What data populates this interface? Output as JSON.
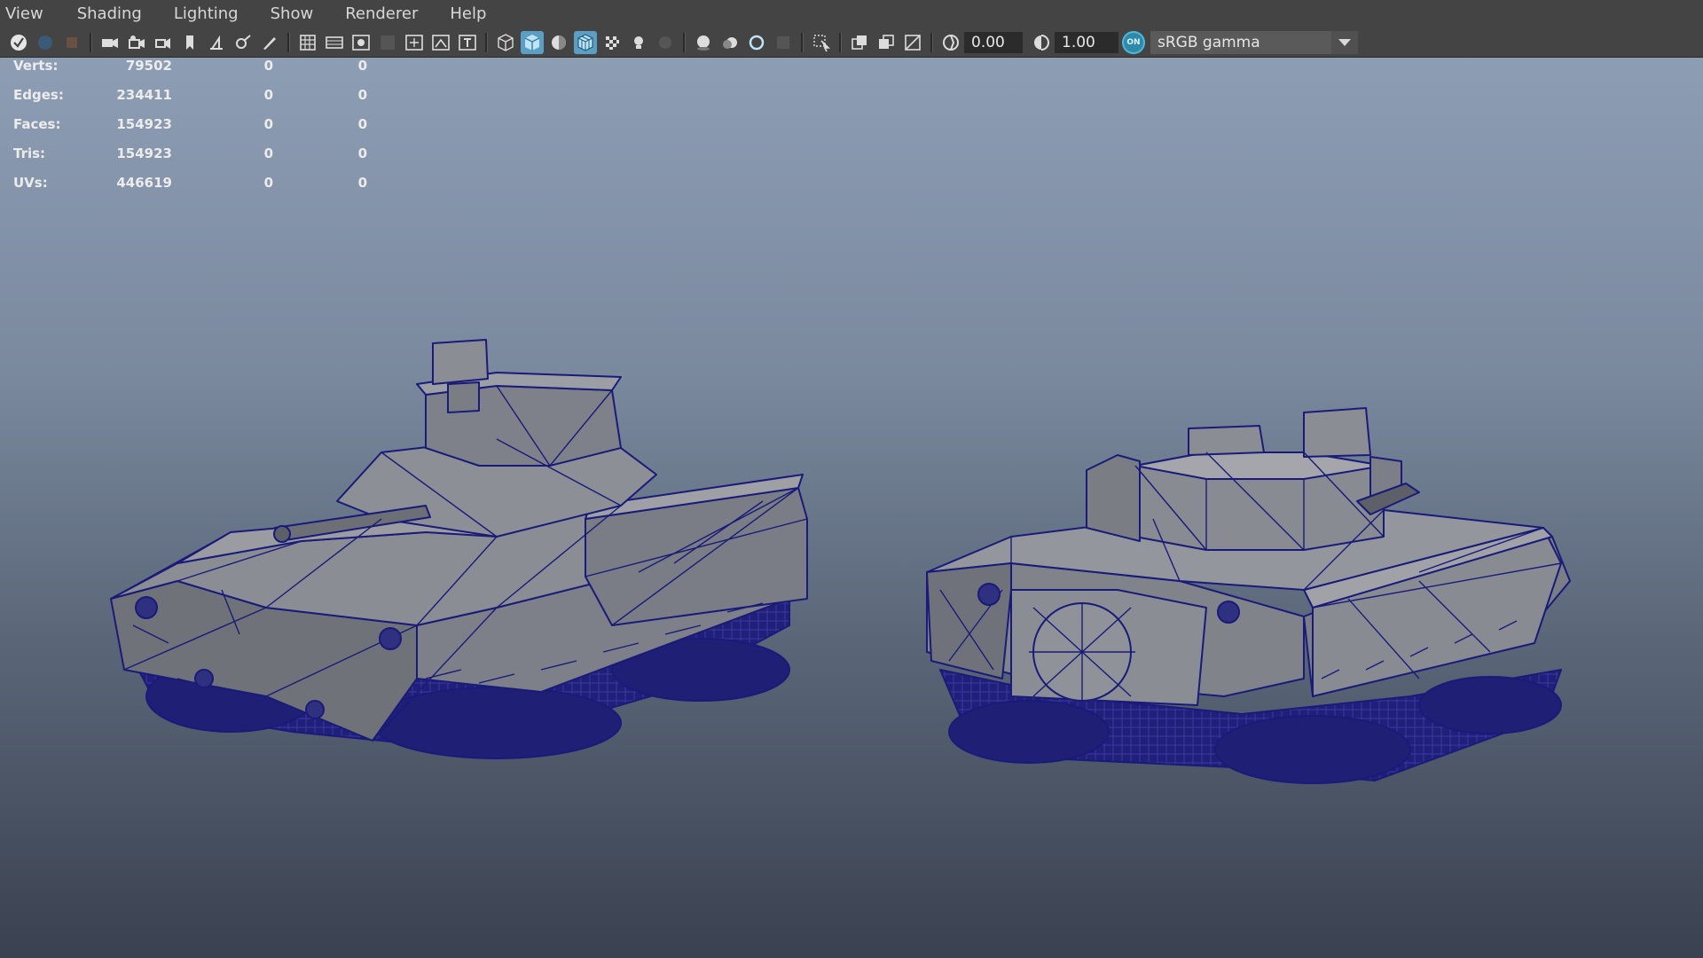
{
  "menu": [
    "View",
    "Shading",
    "Lighting",
    "Show",
    "Renderer",
    "Help"
  ],
  "toolbar": {
    "exposure": "0.00",
    "gamma": "1.00",
    "colorspace_toggle": "ON",
    "colorspace": "sRGB gamma",
    "icons": [
      "select-camera-icon",
      "camera-icon",
      "camera-attr-icon",
      "bookmark-icon",
      "image-plane-icon",
      "grid-icon",
      "film-gate-icon",
      "resolution-gate-icon",
      "safe-action-icon",
      "wireframe-icon",
      "smooth-shade-icon",
      "textured-icon",
      "xray-icon",
      "lights-icon",
      "shadows-icon",
      "isolate-icon",
      "exposure-icon",
      "gamma-icon"
    ]
  },
  "hud": [
    {
      "label": "Verts:",
      "v1": "79502",
      "v2": "0",
      "v3": "0"
    },
    {
      "label": "Edges:",
      "v1": "234411",
      "v2": "0",
      "v3": "0"
    },
    {
      "label": "Faces:",
      "v1": "154923",
      "v2": "0",
      "v3": "0"
    },
    {
      "label": "Tris:",
      "v1": "154923",
      "v2": "0",
      "v3": "0"
    },
    {
      "label": "UVs:",
      "v1": "446619",
      "v2": "0",
      "v3": "0"
    }
  ],
  "colors": {
    "ui_bg": "#444444",
    "accent": "#5c9fc4",
    "wire": "#1a1a78",
    "mesh": "#7c7f86"
  }
}
